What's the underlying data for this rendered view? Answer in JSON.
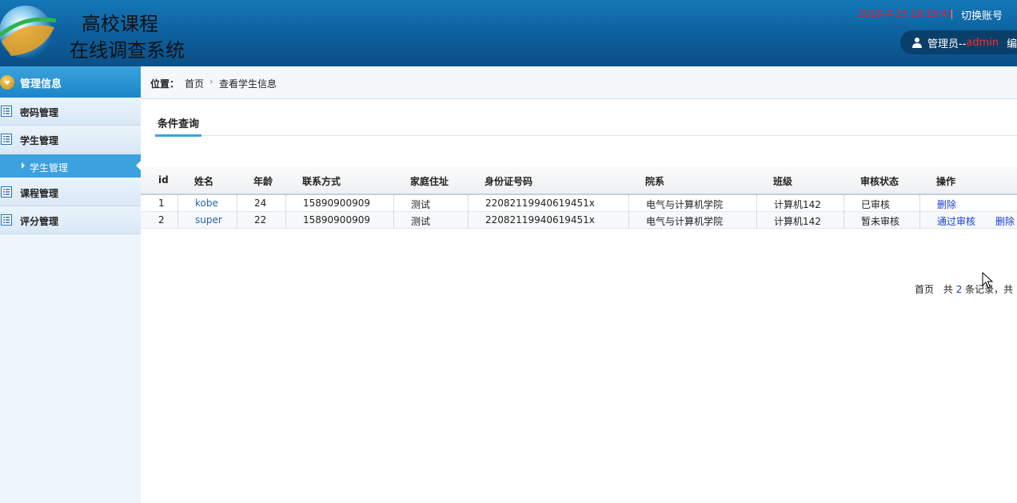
{
  "header": {
    "title_line1": "高校课程",
    "title_line2": "在线调查系统",
    "datetime": "2018-4-15 19:15:41",
    "switch_account": "切换账号",
    "user_prefix": "管理员--",
    "user_name": "admin",
    "user_extra": "编"
  },
  "sidebar": {
    "head": "管理信息",
    "items": [
      {
        "label": "密码管理"
      },
      {
        "label": "学生管理"
      },
      {
        "label": "课程管理"
      },
      {
        "label": "评分管理"
      }
    ],
    "sub_item": "学生管理"
  },
  "breadcrumb": {
    "position_label": "位置：",
    "home": "首页",
    "separator": "›",
    "current": "查看学生信息"
  },
  "tab": {
    "label": "条件查询"
  },
  "table": {
    "headers": [
      "id",
      "姓名",
      "年龄",
      "联系方式",
      "家庭住址",
      "身份证号码",
      "院系",
      "班级",
      "审核状态",
      "操作"
    ],
    "rows": [
      {
        "id": "1",
        "name": "kobe",
        "age": "24",
        "phone": "15890900909",
        "address": "测试",
        "idcard": "22082119940619451x",
        "dept": "电气与计算机学院",
        "class": "计算机142",
        "status": "已审核",
        "action1": "删除",
        "action2": ""
      },
      {
        "id": "2",
        "name": "super",
        "age": "22",
        "phone": "15890900909",
        "address": "测试",
        "idcard": "22082119940619451x",
        "dept": "电气与计算机学院",
        "class": "计算机142",
        "status": "暂未审核",
        "action1": "通过审核",
        "action2": "删除"
      }
    ]
  },
  "pager": {
    "first": "首页",
    "total_prefix": "共",
    "total_count": "2",
    "total_suffix": "条记录，共"
  }
}
